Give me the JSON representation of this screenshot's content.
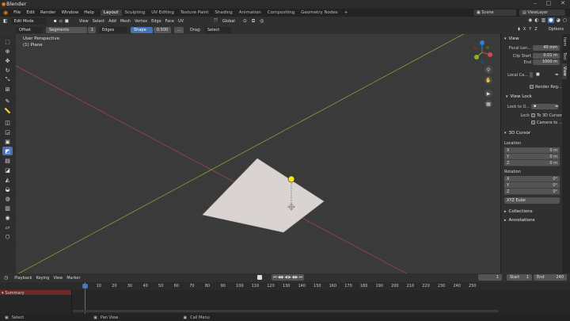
{
  "title_bar": {
    "title": "Blender"
  },
  "menu": {
    "items": [
      "File",
      "Edit",
      "Render",
      "Window",
      "Help"
    ],
    "workspaces": [
      "Layout",
      "Sculpting",
      "UV Editing",
      "Texture Paint",
      "Shading",
      "Animation",
      "Compositing",
      "Geometry Nodes"
    ],
    "active_workspace": "Layout",
    "add_tab": "+",
    "scene_label": "Scene",
    "view_layer_label": "ViewLayer"
  },
  "tool_settings": {
    "offset": "Offset",
    "segments_label": "Segments",
    "segments_value": "1",
    "edges": "Edges",
    "shape_label": "Shape",
    "shape_value": "0.500",
    "more": "...",
    "drag_label": "Drag:",
    "drag_value": "Select Box"
  },
  "header": {
    "mode": "Edit Mode",
    "menu": [
      "View",
      "Select",
      "Add",
      "Mesh",
      "Vertex",
      "Edge",
      "Face",
      "UV"
    ],
    "transform_orientation": "Global",
    "options": "Options",
    "axes": [
      "X",
      "Y",
      "Z"
    ]
  },
  "viewport": {
    "view_name": "User Perspective",
    "object_name": "(1) Plane",
    "gizmo_axes": [
      "X",
      "Y",
      "Z"
    ]
  },
  "npanel": {
    "tabs": [
      "Item",
      "Tool",
      "View"
    ],
    "active_tab": "View",
    "view": {
      "title": "View",
      "focal_label": "Focal Len...",
      "focal_value": "40 mm",
      "clip_start_label": "Clip Start",
      "clip_start_value": "0.01 m",
      "end_label": "End",
      "end_value": "1000 m",
      "local_camera_label": "Local Ca...",
      "render_region_label": "Render Reg..."
    },
    "view_lock": {
      "title": "View Lock",
      "lock_to_object_label": "Lock to O...",
      "lock_label": "Lock",
      "to_3d_cursor": "To 3D Cursor",
      "camera_to": "Camera to ..."
    },
    "cursor": {
      "title": "3D Cursor",
      "location_label": "Location",
      "location": [
        {
          "axis": "X",
          "value": "0 m"
        },
        {
          "axis": "Y",
          "value": "0 m"
        },
        {
          "axis": "Z",
          "value": "0 m"
        }
      ],
      "rotation_label": "Rotation",
      "rotation": [
        {
          "axis": "X",
          "value": "0°"
        },
        {
          "axis": "Y",
          "value": "0°"
        },
        {
          "axis": "Z",
          "value": "0°"
        }
      ],
      "rotation_mode": "XYZ Euler"
    },
    "collections": "Collections",
    "annotations": "Annotations"
  },
  "timeline": {
    "playback": "Playback",
    "keying": "Keying",
    "view": "View",
    "marker": "Marker",
    "current_frame": "1",
    "start_label": "Start",
    "start_value": "1",
    "end_label": "End",
    "end_value": "240",
    "ruler": [
      "1",
      "10",
      "20",
      "30",
      "40",
      "50",
      "60",
      "70",
      "80",
      "90",
      "100",
      "110",
      "120",
      "130",
      "140",
      "150",
      "160",
      "170",
      "180",
      "190",
      "200",
      "210",
      "220",
      "230",
      "240",
      "250"
    ],
    "channel_summary": "Summary"
  },
  "status_bar": {
    "select": "Select",
    "pan_view": "Pan View",
    "call_menu": "Call Menu"
  },
  "colors": {
    "accent": "#4772b3",
    "x_axis": "#a0434c",
    "y_axis": "#8a9a3a",
    "light_yellow": "#f5e61c",
    "plane": "#d9d4d2"
  }
}
